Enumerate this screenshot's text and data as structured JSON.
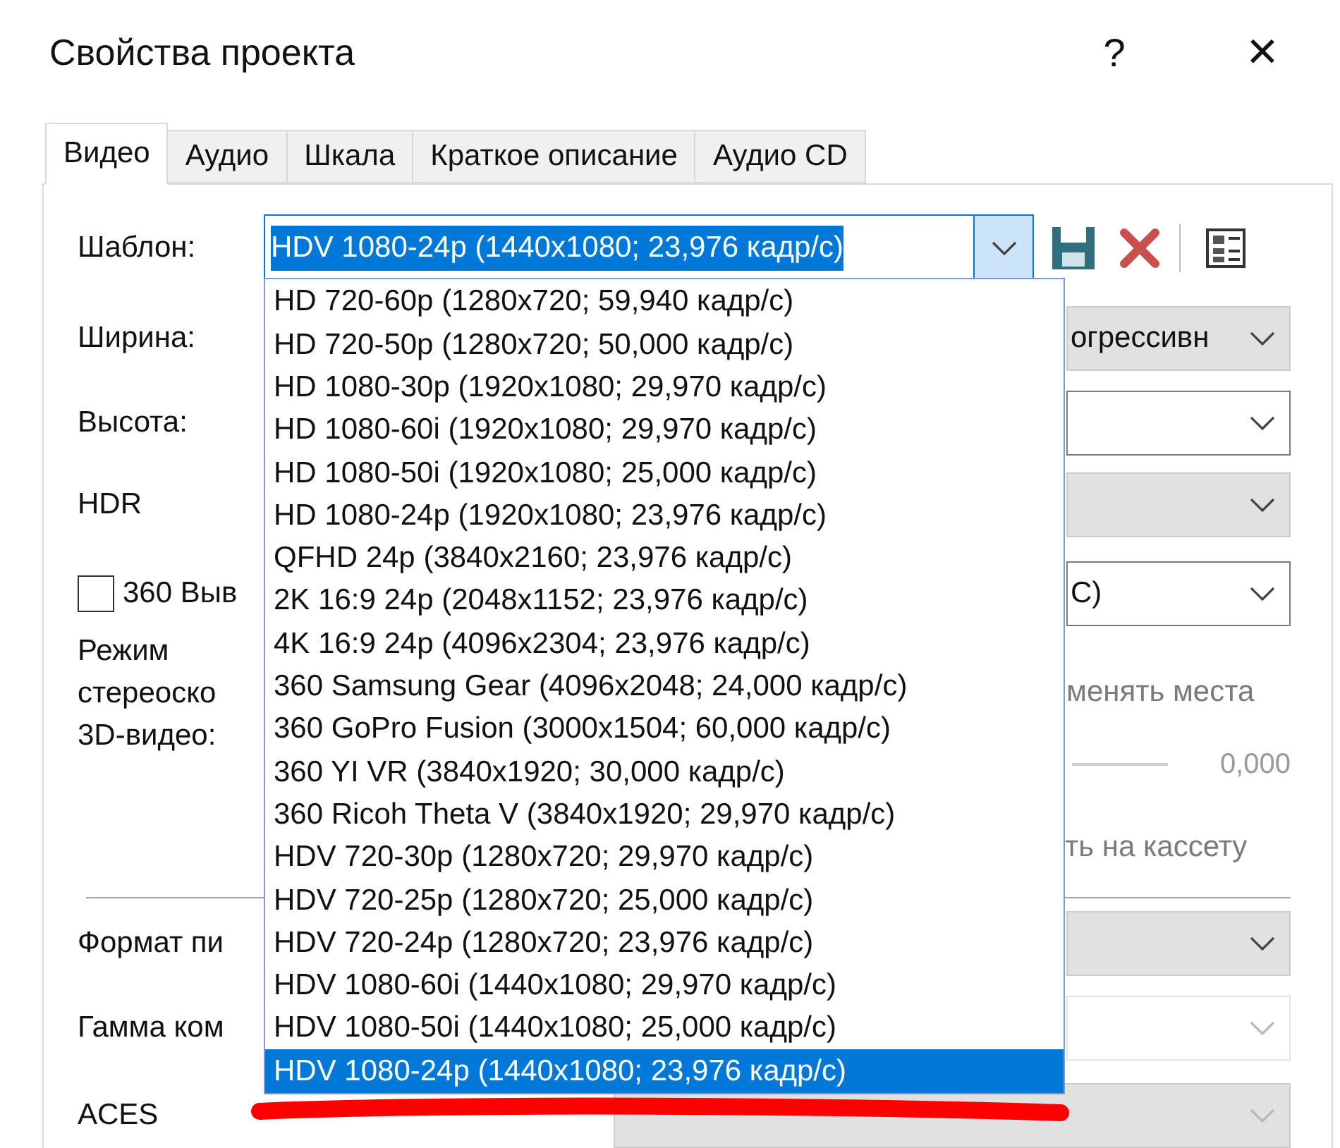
{
  "window": {
    "title": "Свойства проекта",
    "help": "?",
    "close": "×"
  },
  "tabs": [
    {
      "label": "Видео",
      "selected": true
    },
    {
      "label": "Аудио",
      "selected": false
    },
    {
      "label": "Шкала",
      "selected": false
    },
    {
      "label": "Краткое описание",
      "selected": false
    },
    {
      "label": "Аудио CD",
      "selected": false
    }
  ],
  "template": {
    "label": "Шаблон:",
    "value": "HDV 1080-24p (1440x1080; 23,976 кадр/с)",
    "expanded": true
  },
  "dropdown_items": [
    {
      "label": "HD 720-60p (1280x720; 59,940 кадр/с)",
      "selected": false
    },
    {
      "label": "HD 720-50p (1280x720; 50,000 кадр/с)",
      "selected": false
    },
    {
      "label": "HD 1080-30p (1920x1080; 29,970 кадр/с)",
      "selected": false
    },
    {
      "label": "HD 1080-60i (1920x1080; 29,970 кадр/с)",
      "selected": false
    },
    {
      "label": "HD 1080-50i (1920x1080; 25,000 кадр/с)",
      "selected": false
    },
    {
      "label": "HD 1080-24p (1920x1080; 23,976 кадр/с)",
      "selected": false
    },
    {
      "label": "QFHD 24p (3840x2160; 23,976 кадр/с)",
      "selected": false
    },
    {
      "label": "2K 16:9 24p (2048x1152; 23,976 кадр/с)",
      "selected": false
    },
    {
      "label": "4K 16:9 24p (4096x2304; 23,976 кадр/с)",
      "selected": false
    },
    {
      "label": "360 Samsung Gear (4096x2048; 24,000 кадр/с)",
      "selected": false
    },
    {
      "label": "360 GoPro Fusion (3000x1504; 60,000 кадр/с)",
      "selected": false
    },
    {
      "label": "360 YI VR (3840x1920; 30,000 кадр/с)",
      "selected": false
    },
    {
      "label": "360 Ricoh Theta V (3840x1920; 29,970 кадр/с)",
      "selected": false
    },
    {
      "label": "HDV 720-30p (1280x720; 29,970 кадр/с)",
      "selected": false
    },
    {
      "label": "HDV 720-25p (1280x720; 25,000 кадр/с)",
      "selected": false
    },
    {
      "label": "HDV 720-24p (1280x720; 23,976 кадр/с)",
      "selected": false
    },
    {
      "label": "HDV 1080-60i (1440x1080; 29,970 кадр/с)",
      "selected": false
    },
    {
      "label": "HDV 1080-50i (1440x1080; 25,000 кадр/с)",
      "selected": false
    },
    {
      "label": "HDV 1080-24p (1440x1080; 23,976 кадр/с)",
      "selected": true
    }
  ],
  "rows_top": [
    {
      "kind": "combo",
      "label": "Ширина:",
      "value": "огрессивн",
      "shaded": true
    },
    {
      "kind": "combo",
      "label": "Высота:",
      "shaded": false
    },
    {
      "kind": "combo",
      "label": "HDR",
      "shaded": true
    },
    {
      "kind": "checkbox",
      "label": "360 Выв",
      "checked": false,
      "value": "С)",
      "shaded": false
    }
  ],
  "stereo": {
    "label_lines": [
      "Режим",
      "стереоско",
      "3D-видео:"
    ],
    "swap_label": "менять места",
    "slider_reading": "0,000",
    "tape_label": "ть на кассету",
    "disabled": true
  },
  "rows_bottom": [
    {
      "kind": "combo",
      "label": "Формат пи",
      "shaded": true
    },
    {
      "kind": "combo",
      "label": "Гамма ком",
      "shaded": false,
      "disabled": true
    },
    {
      "kind": "wide-combo",
      "label": "ACES",
      "shaded": true
    }
  ]
}
